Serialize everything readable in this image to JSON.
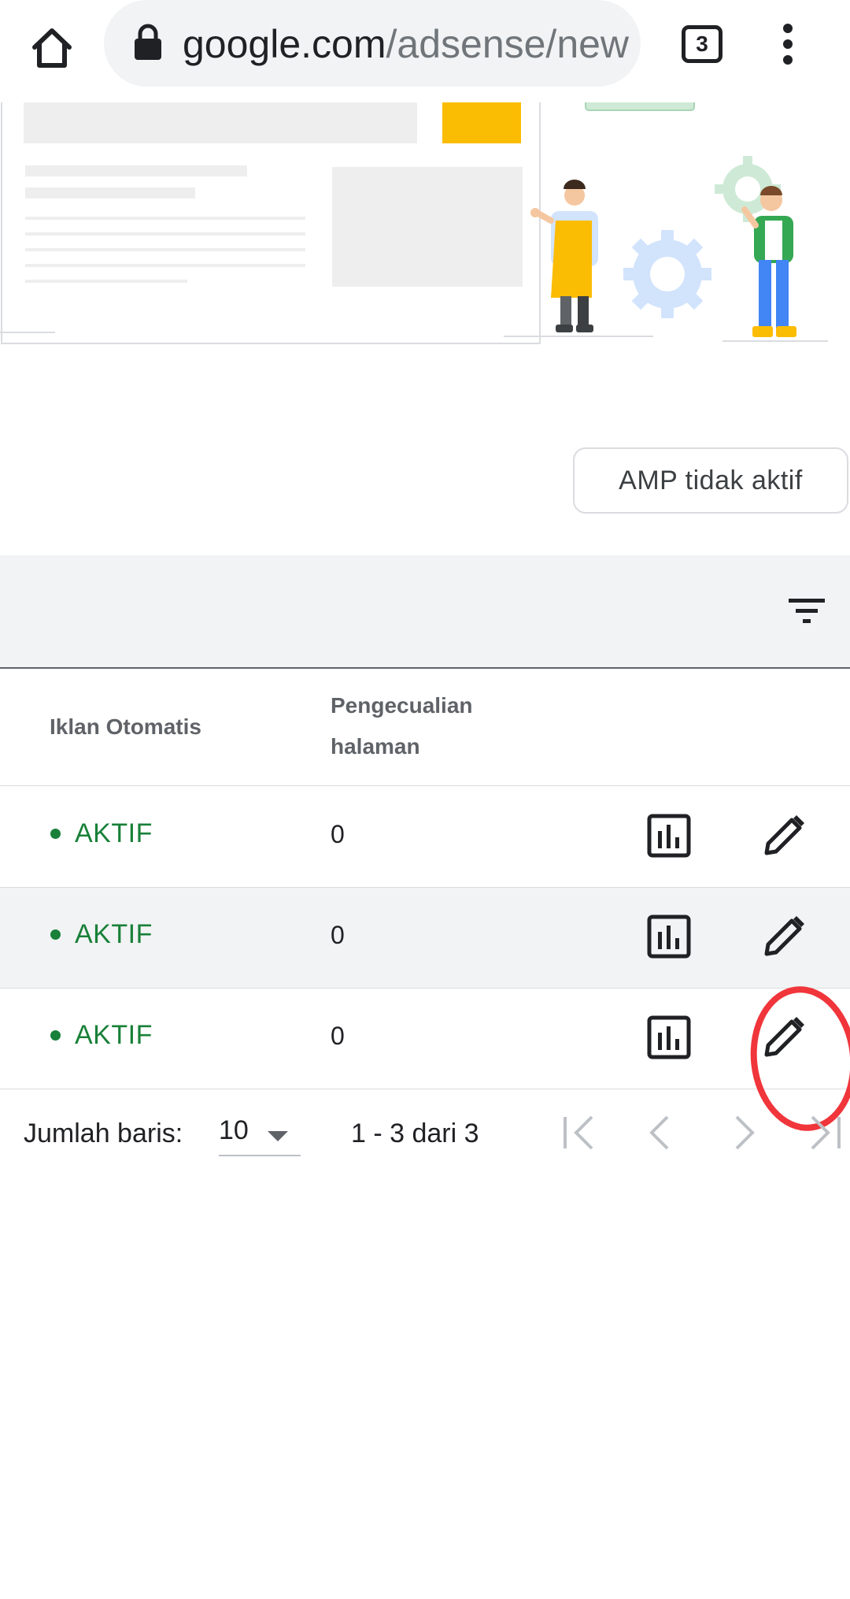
{
  "browser": {
    "url_host": "google.com",
    "url_path": "/adsense/new",
    "tab_count": "3",
    "icons": [
      "home-icon",
      "lock-icon",
      "tabs-icon",
      "more-vert-icon"
    ]
  },
  "actions": {
    "amp_label": "AMP tidak aktif"
  },
  "table": {
    "columns": {
      "auto_ads": "Iklan Otomatis",
      "page_exclusions": "Pengecualian halaman"
    },
    "rows": [
      {
        "status": "AKTIF",
        "exclusions": "0"
      },
      {
        "status": "AKTIF",
        "exclusions": "0"
      },
      {
        "status": "AKTIF",
        "exclusions": "0"
      }
    ]
  },
  "pagination": {
    "rows_label": "Jumlah baris:",
    "rows_value": "10",
    "range_text": "1 - 3 dari 3"
  },
  "colors": {
    "active_green": "#188038",
    "annotation_red": "#f0353b",
    "accent_yellow": "#fbbc04"
  }
}
